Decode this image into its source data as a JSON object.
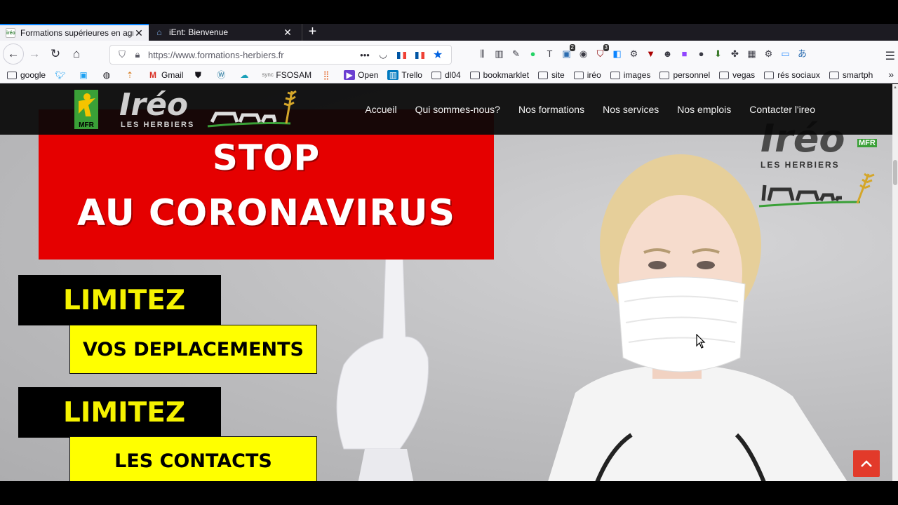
{
  "browser": {
    "tabs": [
      {
        "label": "Formations supérieures en agri",
        "favicon": "ireo",
        "active": true
      },
      {
        "label": "iEnt: Bienvenue",
        "favicon": "house-icon",
        "active": false
      }
    ],
    "new_tab": "+",
    "url": "https://www.formations-herbiers.fr",
    "url_actions": {
      "more": "•••"
    },
    "bookmarks": [
      {
        "label": "google",
        "type": "folder"
      },
      {
        "label": "",
        "type": "twitter-icon"
      },
      {
        "label": "",
        "type": "twitter-icon"
      },
      {
        "label": "",
        "type": "globe-icon"
      },
      {
        "label": "",
        "type": "chart-icon"
      },
      {
        "label": "Gmail",
        "type": "gmail-icon"
      },
      {
        "label": "",
        "type": "shield-icon"
      },
      {
        "label": "",
        "type": "wordpress-icon"
      },
      {
        "label": "",
        "type": "cloud-icon"
      },
      {
        "label": "FSOSAM",
        "type": "sync-icon"
      },
      {
        "label": "",
        "type": "bars-icon"
      },
      {
        "label": "Open",
        "type": "open-icon"
      },
      {
        "label": "Trello",
        "type": "trello-icon"
      },
      {
        "label": "dl04",
        "type": "folder"
      },
      {
        "label": "bookmarklet",
        "type": "folder"
      },
      {
        "label": "site",
        "type": "folder"
      },
      {
        "label": "iréo",
        "type": "folder"
      },
      {
        "label": "images",
        "type": "folder"
      },
      {
        "label": "personnel",
        "type": "folder"
      },
      {
        "label": "vegas",
        "type": "folder"
      },
      {
        "label": "rés sociaux",
        "type": "folder"
      },
      {
        "label": "smartph",
        "type": "folder"
      }
    ],
    "extension_badges": {
      "ext1": "2",
      "ext2": "3"
    }
  },
  "site": {
    "logo": {
      "word": "Iréo",
      "sub": "LES HERBIERS",
      "badge": "MFR"
    },
    "menu": [
      "Accueil",
      "Qui sommes-nous?",
      "Nos formations",
      "Nos services",
      "Nos emplois",
      "Contacter l'ireo"
    ],
    "banner": {
      "line1": "STOP",
      "line2": "AU CORONAVIRUS"
    },
    "messages": [
      {
        "label": "LIMITEZ",
        "detail": "VOS DEPLACEMENTS"
      },
      {
        "label": "LIMITEZ",
        "detail": "LES CONTACTS"
      }
    ],
    "watermark_logo": {
      "word": "Iréo",
      "sub": "LES HERBIERS",
      "badge": "MFR"
    },
    "scroll_top": "^"
  },
  "colors": {
    "accent": "#0a84ff",
    "banner_red": "#e50000",
    "yellow": "#ffff00",
    "scroll_top": "#e23a2a"
  }
}
